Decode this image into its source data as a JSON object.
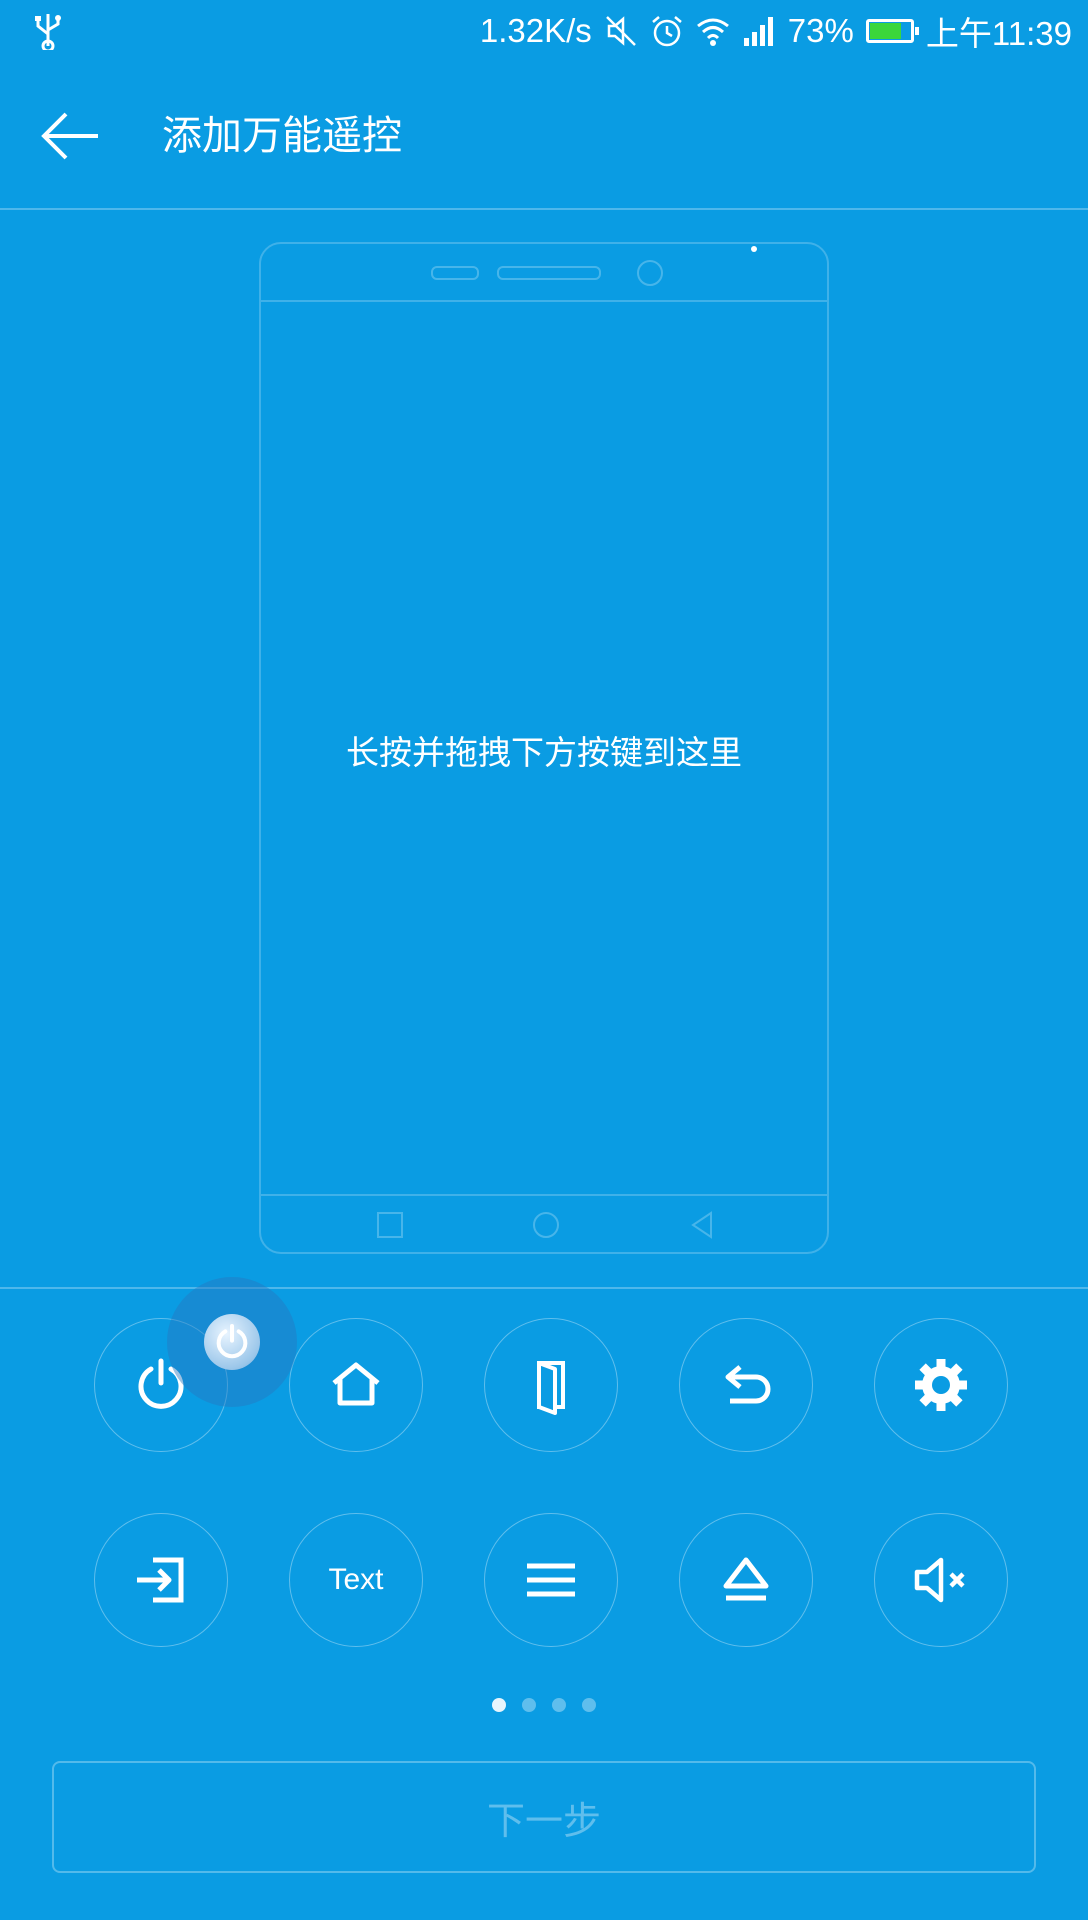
{
  "status_bar": {
    "network_speed": "1.32K/s",
    "battery_percent": "73%",
    "battery_level": 0.73,
    "time": "上午11:39",
    "icons": [
      "usb-icon",
      "mute-icon",
      "alarm-icon",
      "wifi-icon",
      "signal-icon",
      "battery-icon"
    ]
  },
  "app_bar": {
    "title": "添加万能遥控",
    "back_icon": "arrow-left-icon"
  },
  "canvas": {
    "hint": "长按并拖拽下方按键到这里"
  },
  "keys": {
    "row1": [
      "power-icon",
      "home-icon",
      "door-icon",
      "return-icon",
      "settings-icon"
    ],
    "row2": [
      "input-icon",
      "text",
      "menu-icon",
      "eject-icon",
      "mute-icon"
    ],
    "text_label": "Text"
  },
  "pager": {
    "pages": 4,
    "active": 1
  },
  "next_button": {
    "label": "下一步",
    "enabled": false
  },
  "colors": {
    "background": "#0a9ce3",
    "battery_fill": "#3bd63b"
  }
}
